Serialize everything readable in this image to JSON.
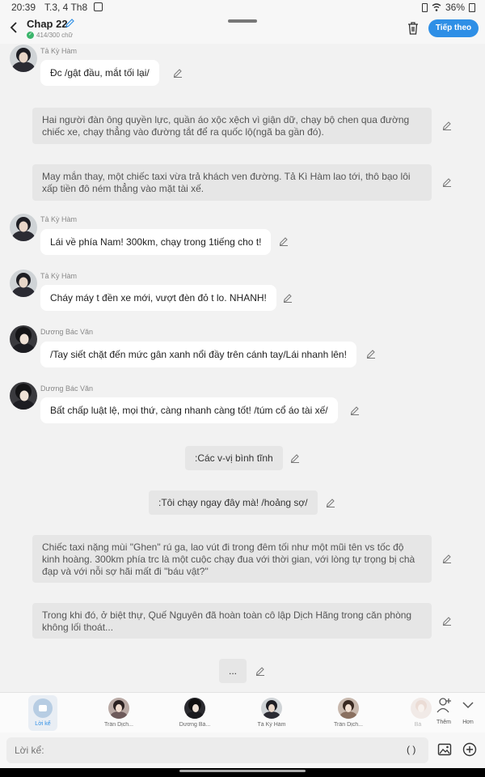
{
  "status_bar": {
    "time": "20:39",
    "date": "T.3, 4 Th8",
    "battery": "36%"
  },
  "header": {
    "title": "Chap 22",
    "word_count": "414/300 chữ",
    "next_button": "Tiếp theo"
  },
  "messages": [
    {
      "type": "character",
      "speaker": "Tả Kỳ Hàm",
      "text": "Đc /gật đầu, mắt tối lại/"
    },
    {
      "type": "narration",
      "text": "Hai người đàn ông quyền lực, quần áo xộc xệch vì giận dữ, chạy bộ chen qua đường chiếc xe, chạy thẳng vào đường tắt để ra quốc lộ(ngã ba gần đó)."
    },
    {
      "type": "narration",
      "text": "May mắn thay, một chiếc taxi vừa trả khách ven đường. Tả Kì Hàm lao tới, thô bạo lôi xấp tiền đô ném thẳng vào mặt tài xế."
    },
    {
      "type": "character",
      "speaker": "Tả Kỳ Hàm",
      "text": "Lái về phía Nam! 300km, chạy trong 1tiếng cho t!"
    },
    {
      "type": "character",
      "speaker": "Tả Kỳ Hàm",
      "text": "Cháy máy t đền xe mới, vượt đèn đỏ t lo. NHANH!"
    },
    {
      "type": "character",
      "speaker": "Dương Bác Văn",
      "text": "/Tay siết chặt đến mức gân xanh nổi đầy trên cánh tay/Lái nhanh lên!"
    },
    {
      "type": "character",
      "speaker": "Dương Bác Văn",
      "text": "Bất chấp luật lệ, mọi thứ, càng nhanh càng tốt! /túm cổ áo tài xế/"
    },
    {
      "type": "system",
      "text": ":Các v-vị bình tĩnh"
    },
    {
      "type": "system",
      "text": ":Tôi chạy ngay đây mà! /hoảng sợ/"
    },
    {
      "type": "narration",
      "text": "Chiếc taxi nặng mùi \"Ghen\" rú ga, lao vút đi trong đêm tối như một mũi tên vs tốc độ kinh hoàng. 300km phía trc là một cuộc chạy đua với thời gian, với lòng tự trọng bị chà đạp và với nỗi sợ hãi mất đi \"báu vật?\""
    },
    {
      "type": "narration",
      "text": "Trong khi đó, ở biệt thự, Quế Nguyên đã hoàn toàn cô lập Dịch Hãng trong căn phòng không lối thoát..."
    },
    {
      "type": "system",
      "text": "..."
    }
  ],
  "character_bar": {
    "narration_label": "Lời kể",
    "characters": [
      "Trần Dịch...",
      "Dương Bá...",
      "Tả Kỳ Hàm",
      "Trần Dịch...",
      "Bá"
    ],
    "add_label": "Thêm",
    "more_label": "Hơn"
  },
  "input": {
    "placeholder": "Lời kể:",
    "paren_button": "( )"
  },
  "icons": [
    "back-icon",
    "pencil-icon",
    "trash-icon",
    "image-icon",
    "plus-icon",
    "person-add-icon",
    "chevron-down-icon"
  ],
  "colors": {
    "accent": "#2e8fe6",
    "narration_bg": "#e6e6e6",
    "bubble_bg": "#ffffff",
    "page_bg": "#f2f2f2"
  }
}
